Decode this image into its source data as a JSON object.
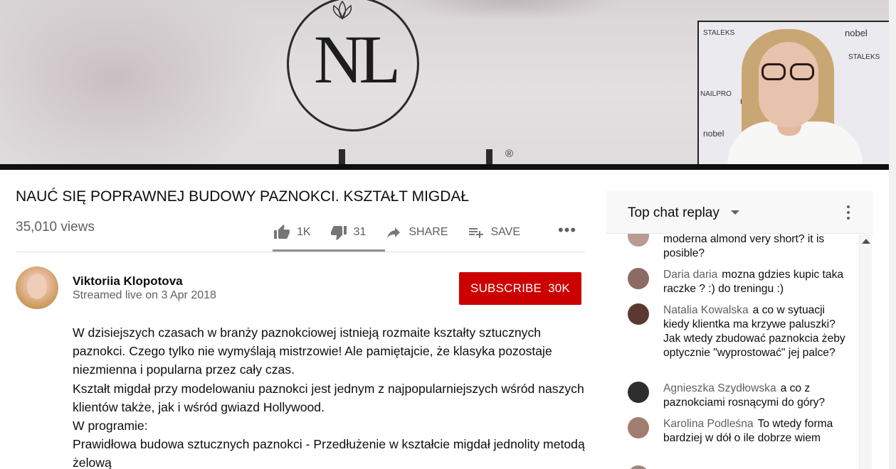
{
  "video": {
    "logo_letters": "NL",
    "registered_mark": "®",
    "webcam_brands": [
      "nobel",
      "STALEKS",
      "NAILPRO"
    ]
  },
  "info": {
    "title": "NAUĆ SIĘ POPRAWNEJ BUDOWY PAZNOKCI. KSZTAŁT MIGDAŁ",
    "views": "35,010 views",
    "likes": "1K",
    "dislikes": "31",
    "share_label": "SHARE",
    "save_label": "SAVE",
    "like_ratio": 0.75
  },
  "channel": {
    "name": "Viktoriia Klopotova",
    "streamed": "Streamed live on 3 Apr 2018",
    "subscribe_label": "SUBSCRIBE",
    "subscriber_count": "30K"
  },
  "description": {
    "lines": [
      "W dzisiejszych czasach w branży paznokciowej istnieją rozmaite kształty sztucznych",
      "paznokci. Czego tylko nie wymyślają mistrzowie! Ale pamiętajcie, że klasyka pozostaje",
      "niezmienna i popularna przez cały czas.",
      "Kształt migdał przy modelowaniu paznokci jest jednym z najpopularniejszych wśród naszych",
      "klientów także, jak i wśród gwiazd Hollywood.",
      "W programie:",
      "Prawidłowa budowa sztucznych paznokci - Przedłużenie w kształcie migdał jednolity metodą",
      "żelową"
    ]
  },
  "chat": {
    "title": "Top chat replay",
    "messages": [
      {
        "author": "",
        "text": "moderna almond very short? it is posible?"
      },
      {
        "author": "Daria daria",
        "text": "mozna gdzies kupic taka raczke ? :) do treningu :)"
      },
      {
        "author": "Natalia Kowalska",
        "text": "a co w sytuacji kiedy klientka ma krzywe paluszki? Jak wtedy zbudować paznokcia żeby optycznie \"wyprostować\" jej palce?"
      },
      {
        "author": "Agnieszka Szydłowska",
        "text": "a co z paznokciami rosnącymi do góry?"
      },
      {
        "author": "Karolina Podleśna",
        "text": "To wtedy forma bardziej w dół o ile dobrze wiem"
      }
    ]
  },
  "colors": {
    "subscribe_red": "#cc0000",
    "secondary_text": "#606060",
    "primary_text": "#0d0d0d",
    "chat_header_bg": "#f8f8f8"
  },
  "icons": [
    "thumbs-up-icon",
    "thumbs-down-icon",
    "share-icon",
    "save-playlist-icon",
    "more-icon",
    "chat-menu-icon",
    "caret-down-icon"
  ]
}
